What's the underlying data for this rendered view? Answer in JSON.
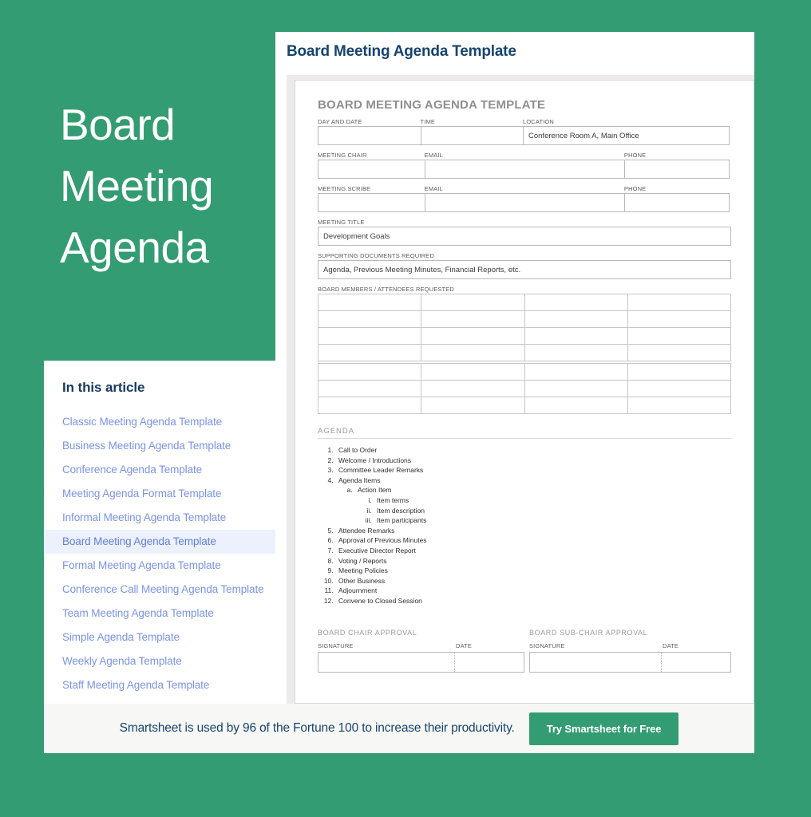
{
  "colors": {
    "brand_green": "#349c72",
    "title_navy": "#15446e",
    "link_blue": "#7b93e8",
    "active_bg": "#edf1fd",
    "footer_bg": "#f7f7f5"
  },
  "hero": {
    "title": "Board\nMeeting\nAgenda"
  },
  "sidebar": {
    "heading": "In this article",
    "items": [
      {
        "label": "Classic Meeting Agenda Template",
        "active": false
      },
      {
        "label": "Business Meeting Agenda Template",
        "active": false
      },
      {
        "label": "Conference Agenda Template",
        "active": false
      },
      {
        "label": "Meeting Agenda Format Template",
        "active": false
      },
      {
        "label": "Informal Meeting Agenda Template",
        "active": false
      },
      {
        "label": "Board Meeting Agenda Template",
        "active": true
      },
      {
        "label": "Formal Meeting Agenda Template",
        "active": false
      },
      {
        "label": "Conference Call Meeting Agenda Template",
        "active": false
      },
      {
        "label": "Team Meeting Agenda Template",
        "active": false
      },
      {
        "label": "Simple Agenda Template",
        "active": false
      },
      {
        "label": "Weekly Agenda Template",
        "active": false
      },
      {
        "label": "Staff Meeting Agenda Template",
        "active": false
      }
    ]
  },
  "document": {
    "panel_title": "Board Meeting Agenda Template",
    "template_title": "BOARD MEETING AGENDA TEMPLATE",
    "fields": {
      "day_and_date_label": "DAY AND DATE",
      "day_and_date_value": "",
      "time_label": "TIME",
      "time_value": "",
      "location_label": "LOCATION",
      "location_value": "Conference Room A, Main Office",
      "meeting_chair_label": "MEETING CHAIR",
      "meeting_chair_value": "",
      "chair_email_label": "EMAIL",
      "chair_email_value": "",
      "chair_phone_label": "PHONE",
      "chair_phone_value": "",
      "meeting_scribe_label": "MEETING SCRIBE",
      "meeting_scribe_value": "",
      "scribe_email_label": "EMAIL",
      "scribe_email_value": "",
      "scribe_phone_label": "PHONE",
      "scribe_phone_value": "",
      "meeting_title_label": "MEETING TITLE",
      "meeting_title_value": "Development Goals",
      "supporting_docs_label": "SUPPORTING DOCUMENTS REQUIRED",
      "supporting_docs_value": "Agenda, Previous Meeting Minutes, Financial Reports, etc.",
      "attendees_label": "BOARD MEMBERS / ATTENDEES REQUESTED"
    },
    "attendees_grid": {
      "columns": 4,
      "rows_group_1": 4,
      "rows_group_2": 3
    },
    "agenda_heading": "AGENDA",
    "agenda_items": [
      {
        "n": 1,
        "label": "Call to Order"
      },
      {
        "n": 2,
        "label": "Welcome / Introductions"
      },
      {
        "n": 3,
        "label": "Committee Leader Remarks"
      },
      {
        "n": 4,
        "label": "Agenda Items",
        "sub": [
          {
            "label": "Action Item",
            "sub": [
              {
                "label": "Item terms"
              },
              {
                "label": "Item description"
              },
              {
                "label": "Item participants"
              }
            ]
          }
        ]
      },
      {
        "n": 5,
        "label": "Attendee Remarks"
      },
      {
        "n": 6,
        "label": "Approval of Previous Minutes"
      },
      {
        "n": 7,
        "label": "Executive Director Report"
      },
      {
        "n": 8,
        "label": "Voting / Reports"
      },
      {
        "n": 9,
        "label": "Meeting Policies"
      },
      {
        "n": 10,
        "label": "Other Business"
      },
      {
        "n": 11,
        "label": "Adjournment"
      },
      {
        "n": 12,
        "label": "Convene to Closed Session"
      }
    ],
    "approvals": [
      {
        "title": "BOARD CHAIR APPROVAL",
        "signature_label": "SIGNATURE",
        "date_label": "DATE",
        "signature_value": "",
        "date_value": ""
      },
      {
        "title": "BOARD SUB-CHAIR APPROVAL",
        "signature_label": "SIGNATURE",
        "date_label": "DATE",
        "signature_value": "",
        "date_value": ""
      }
    ]
  },
  "footer": {
    "text": "Smartsheet is used by 96 of the Fortune 100 to increase their productivity.",
    "button_label": "Try Smartsheet for Free"
  }
}
